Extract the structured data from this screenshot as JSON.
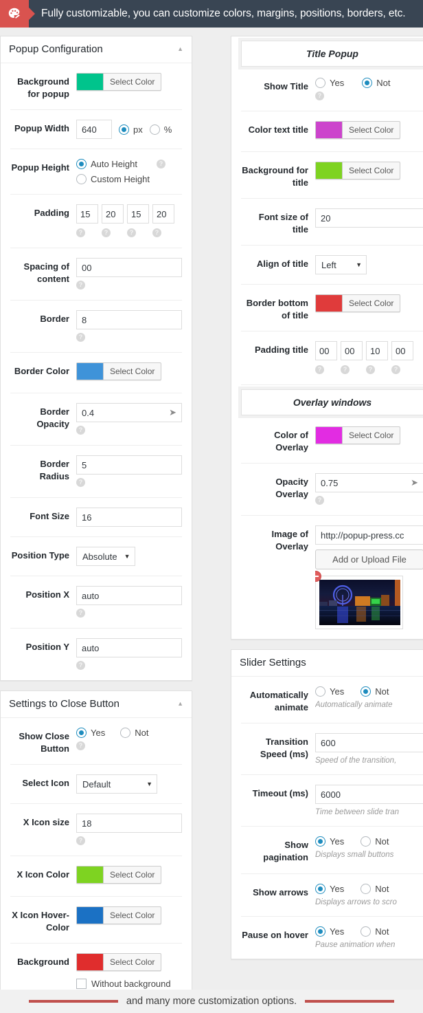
{
  "banner": {
    "icon": "palette-icon",
    "text": "Fully customizable, you can customize colors, margins, positions, borders, etc."
  },
  "footer": {
    "text": "and many more customization options.",
    "rule_color": "#c0504d"
  },
  "common": {
    "select_color_label": "Select Color",
    "yes_label": "Yes",
    "not_label": "Not",
    "help_glyph": "?",
    "caret_up": "▲",
    "caret_down": "▼"
  },
  "popup_configuration": {
    "title": "Popup Configuration",
    "collapse_icon": "caret-up-icon",
    "rows": {
      "background": {
        "label": "Background for popup",
        "color": "#00c48c"
      },
      "width": {
        "label": "Popup Width",
        "value": "640",
        "unit_px": "px",
        "unit_pct": "%",
        "unit_selected": "px"
      },
      "height": {
        "label": "Popup Height",
        "auto": "Auto Height",
        "custom": "Custom Height",
        "selected": "Auto Height"
      },
      "padding": {
        "label": "Padding",
        "values": [
          "15",
          "20",
          "15",
          "20"
        ]
      },
      "spacing": {
        "label": "Spacing of content",
        "value": "00"
      },
      "border": {
        "label": "Border",
        "value": "8"
      },
      "border_color": {
        "label": "Border Color",
        "color": "#3f93d9"
      },
      "border_opacity": {
        "label": "Border Opacity",
        "value": "0.4"
      },
      "border_radius": {
        "label": "Border Radius",
        "value": "5"
      },
      "font_size": {
        "label": "Font Size",
        "value": "16"
      },
      "position_type": {
        "label": "Position Type",
        "value": "Absolute"
      },
      "position_x": {
        "label": "Position X",
        "value": "auto"
      },
      "position_y": {
        "label": "Position Y",
        "value": "auto"
      }
    }
  },
  "close_button_settings": {
    "title": "Settings to Close Button",
    "collapse_icon": "caret-up-icon",
    "rows": {
      "show_close": {
        "label": "Show Close Button",
        "selected": "Yes"
      },
      "select_icon": {
        "label": "Select Icon",
        "value": "Default"
      },
      "x_icon_size": {
        "label": "X Icon size",
        "value": "18"
      },
      "x_icon_color": {
        "label": "X Icon Color",
        "color": "#7ed321"
      },
      "x_icon_hover_color": {
        "label": "X Icon Hover-Color",
        "color": "#1b71c4"
      },
      "background": {
        "label": "Background",
        "color": "#e02d2d",
        "without_background": "Without background",
        "without_checked": false
      }
    }
  },
  "title_popup": {
    "heading": "Title Popup",
    "rows": {
      "show_title": {
        "label": "Show Title",
        "selected": "Not"
      },
      "color_text_title": {
        "label": "Color text title",
        "color": "#cc44cc"
      },
      "background_title": {
        "label": "Background for title",
        "color": "#7ed321"
      },
      "font_size_title": {
        "label": "Font size of title",
        "value": "20"
      },
      "align_title": {
        "label": "Align of title",
        "value": "Left"
      },
      "border_bottom_title": {
        "label": "Border bottom of title",
        "color": "#e03b3b"
      },
      "padding_title": {
        "label": "Padding title",
        "values": [
          "00",
          "00",
          "10",
          "00"
        ]
      }
    }
  },
  "overlay_windows": {
    "heading": "Overlay windows",
    "rows": {
      "color_overlay": {
        "label": "Color of Overlay",
        "color": "#e22ce2"
      },
      "opacity_overlay": {
        "label": "Opacity Overlay",
        "value": "0.75"
      },
      "image_overlay": {
        "label": "Image of Overlay",
        "value": "http://popup-press.cc",
        "upload_label": "Add or Upload File",
        "thumbnail_alt": "london-eye-night-cityscape",
        "remove_icon": "remove-circle-icon"
      }
    }
  },
  "slider_settings": {
    "title": "Slider Settings",
    "rows": {
      "auto_animate": {
        "label": "Automatically animate",
        "selected": "Not",
        "desc": "Automatically animate"
      },
      "transition_speed": {
        "label": "Transition Speed (ms)",
        "value": "600",
        "desc": "Speed of the transition,"
      },
      "timeout": {
        "label": "Timeout (ms)",
        "value": "6000",
        "desc": "Time between slide tran"
      },
      "show_pagination": {
        "label": "Show pagination",
        "selected": "Yes",
        "desc": "Displays small buttons"
      },
      "show_arrows": {
        "label": "Show arrows",
        "selected": "Yes",
        "desc": "Displays arrows to scro"
      },
      "pause_on_hover": {
        "label": "Pause on hover",
        "selected": "Yes",
        "desc": "Pause animation when"
      }
    }
  }
}
